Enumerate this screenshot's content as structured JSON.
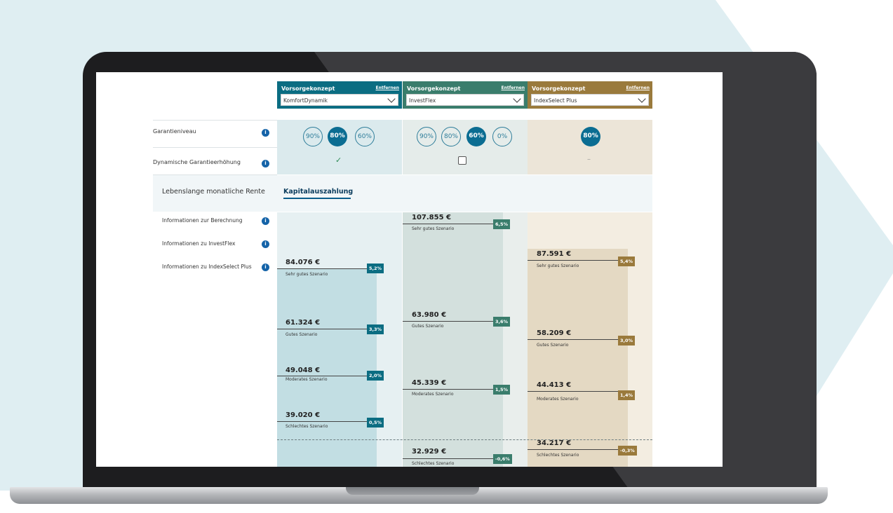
{
  "columns": [
    {
      "header_title": "Vorsorgekonzept",
      "remove_label": "Entfernen",
      "selected_product": "KomfortDynamik",
      "color": "#0b6d82"
    },
    {
      "header_title": "Vorsorgekonzept",
      "remove_label": "Entfernen",
      "selected_product": "InvestFlex",
      "color": "#3a7d6c"
    },
    {
      "header_title": "Vorsorgekonzept",
      "remove_label": "Entfernen",
      "selected_product": "IndexSelect Plus",
      "color": "#9a7a3c"
    }
  ],
  "rows": {
    "garantieniveau": "Garantieniveau",
    "dynamische": "Dynamische Garantieerhöhung"
  },
  "garantie_options": {
    "col1": [
      "90%",
      "80%",
      "60%"
    ],
    "col2": [
      "90%",
      "80%",
      "60%",
      "0%"
    ],
    "col3": [
      "80%"
    ]
  },
  "selected_options": {
    "col1": "80%",
    "col2": "60%",
    "col3": "80%"
  },
  "dynamische_values": {
    "col1": "✓",
    "col2": "",
    "col3": "–"
  },
  "tabs": [
    "Lebenslange monatliche Rente",
    "Kapitalauszahlung"
  ],
  "active_tab": "Kapitalauszahlung",
  "info_links": [
    "Informationen zur Berechnung",
    "Informationen zu InvestFlex",
    "Informationen zu IndexSelect Plus"
  ],
  "info_icon_glyph": "i",
  "scenarios": {
    "col1": [
      {
        "amount": "84.076 €",
        "label": "Sehr gutes Szenario",
        "rate": "5,2%"
      },
      {
        "amount": "61.324 €",
        "label": "Gutes Szenario",
        "rate": "3,3%"
      },
      {
        "amount": "49.048 €",
        "label": "Moderates Szenario",
        "rate": "2,0%"
      },
      {
        "amount": "39.020 €",
        "label": "Schlechtes Szenario",
        "rate": "0,5%"
      }
    ],
    "col2": [
      {
        "amount": "107.855 €",
        "label": "Sehr gutes Szenario",
        "rate": "6,5%"
      },
      {
        "amount": "63.980 €",
        "label": "Gutes Szenario",
        "rate": "3,6%"
      },
      {
        "amount": "45.339 €",
        "label": "Moderates Szenario",
        "rate": "1,5%"
      },
      {
        "amount": "32.929 €",
        "label": "Schlechtes Szenario",
        "rate": "-0,6%"
      }
    ],
    "col3": [
      {
        "amount": "87.591 €",
        "label": "Sehr gutes Szenario",
        "rate": "5,4%"
      },
      {
        "amount": "58.209 €",
        "label": "Gutes Szenario",
        "rate": "3,0%"
      },
      {
        "amount": "44.413 €",
        "label": "Moderates Szenario",
        "rate": "1,4%"
      },
      {
        "amount": "34.217 €",
        "label": "Schlechtes Szenario",
        "rate": "-0,3%"
      }
    ]
  },
  "colors": {
    "background_chevron": "#dfeef2",
    "accent_teal": "#0b6d82",
    "accent_green": "#3a7d6c",
    "accent_gold": "#9a7a3c",
    "info_blue": "#1463a8"
  }
}
